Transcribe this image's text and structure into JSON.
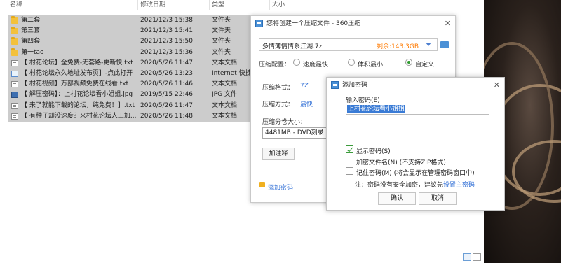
{
  "columns": {
    "name": "名称",
    "date": "修改日期",
    "type": "类型",
    "size": "大小"
  },
  "files": [
    {
      "name": "第二套",
      "date": "2021/12/3 15:38",
      "type": "文件夹",
      "size": "",
      "icon": "folder-icon",
      "selected": true
    },
    {
      "name": "第三套",
      "date": "2021/12/3 15:41",
      "type": "文件夹",
      "size": "",
      "icon": "folder-icon",
      "selected": true
    },
    {
      "name": "第四套",
      "date": "2021/12/3 15:50",
      "type": "文件夹",
      "size": "",
      "icon": "folder-icon",
      "selected": true
    },
    {
      "name": "第一tao",
      "date": "2021/12/3 15:36",
      "type": "文件夹",
      "size": "",
      "icon": "folder-icon",
      "selected": true
    },
    {
      "name": "【 村花论坛】全免费-无套路-更新快.txt",
      "date": "2020/5/26 11:47",
      "type": "文本文档",
      "size": "",
      "icon": "text-file-icon",
      "selected": true
    },
    {
      "name": "【 村花论坛永久地址发布页】-点此打开",
      "date": "2020/5/26 13:23",
      "type": "Internet 快捷方式",
      "size": "",
      "icon": "url-file-icon",
      "selected": true
    },
    {
      "name": "【 村花视频】万部视频免费在线看.txt",
      "date": "2020/5/26 11:46",
      "type": "文本文档",
      "size": "",
      "icon": "text-file-icon",
      "selected": true
    },
    {
      "name": "【 解压密码】：上村花论坛看小姐姐.jpg",
      "date": "2019/5/15 22:46",
      "type": "JPG 文件",
      "size": "",
      "icon": "image-file-icon",
      "selected": true
    },
    {
      "name": "【 来了就能下载的论坛，纯免费！】.txt",
      "date": "2020/5/26 11:47",
      "type": "文本文档",
      "size": "",
      "icon": "text-file-icon",
      "selected": true
    },
    {
      "name": "【 有种子却没速度？来村花论坛人工加...",
      "date": "2020/5/26 11:48",
      "type": "文本文档",
      "size": "",
      "icon": "text-file-icon",
      "selected": true
    }
  ],
  "compress_dialog": {
    "title": "您将创建一个压缩文件 - 360压缩",
    "path": "多情薄情情系江湖.7z",
    "free_space": "剩余:143.3GB",
    "config_label": "压缩配置：",
    "options": [
      "速度最快",
      "体积最小",
      "自定义"
    ],
    "selected_option": "自定义",
    "format_label": "压缩格式：",
    "format_value": "7Z",
    "method_label": "压缩方式：",
    "method_value": "最快",
    "volume_label": "压缩分卷大小：",
    "volume_value": "4481MB  - DVD刻录",
    "comment_button": "加注释",
    "add_password_link": "添加密码"
  },
  "password_dialog": {
    "title": "添加密码",
    "input_label": "输入密码(E)",
    "password_value": "上村花论坛看小姐姐",
    "checkboxes": [
      {
        "label": "显示密码(S)",
        "checked": true
      },
      {
        "label": "加密文件名(N) (不支持ZIP格式)",
        "checked": false
      },
      {
        "label": "记住密码(M) (将会显示在管理密码窗口中)",
        "checked": false
      }
    ],
    "note_prefix": "注：密码没有安全加密，建议先",
    "note_link": "设置主密码",
    "ok_button": "确认",
    "cancel_button": "取消"
  },
  "colors": {
    "selection": "#cccccc",
    "link": "#2f6ed6",
    "free_space": "#ff7a00",
    "password_highlight": "#3a7bd5",
    "checkbox_green": "#2f9b2f"
  }
}
